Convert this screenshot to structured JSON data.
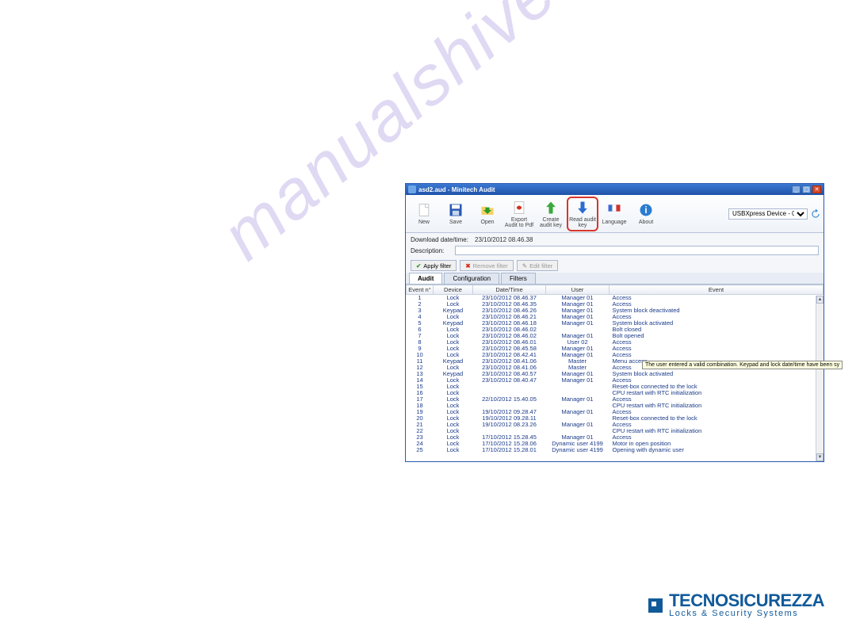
{
  "window": {
    "title": "asd2.aud - Minitech Audit"
  },
  "toolbar": {
    "new": "New",
    "save": "Save",
    "open": "Open",
    "export": "Export\nAudit to Pdf",
    "create": "Create\naudit key",
    "read": "Read audit\nkey",
    "lang": "Language",
    "about": "About"
  },
  "device": {
    "selected": "USBXpress Device - 0"
  },
  "info": {
    "dl_label": "Download date/time:",
    "dl_value": "23/10/2012 08.46.38",
    "desc_label": "Description:",
    "desc_value": ""
  },
  "filters": {
    "apply": "Apply filter",
    "remove": "Remove filter",
    "edit": "Edit filter"
  },
  "tabs": {
    "audit": "Audit",
    "config": "Configuration",
    "filters": "Filters"
  },
  "columns": {
    "n": "Event n°",
    "device": "Device",
    "dt": "Date/Time",
    "user": "User",
    "event": "Event"
  },
  "rows": [
    {
      "n": "1",
      "device": "Lock",
      "dt": "23/10/2012 08.46.37",
      "user": "Manager 01",
      "event": "Access"
    },
    {
      "n": "2",
      "device": "Lock",
      "dt": "23/10/2012 08.46.35",
      "user": "Manager 01",
      "event": "Access"
    },
    {
      "n": "3",
      "device": "Keypad",
      "dt": "23/10/2012 08.46.26",
      "user": "Manager 01",
      "event": "System block deactivated"
    },
    {
      "n": "4",
      "device": "Lock",
      "dt": "23/10/2012 08.46.21",
      "user": "Manager 01",
      "event": "Access"
    },
    {
      "n": "5",
      "device": "Keypad",
      "dt": "23/10/2012 08.46.18",
      "user": "Manager 01",
      "event": "System block activated"
    },
    {
      "n": "6",
      "device": "Lock",
      "dt": "23/10/2012 08.46.02",
      "user": "",
      "event": "Bolt closed"
    },
    {
      "n": "7",
      "device": "Lock",
      "dt": "23/10/2012 08.46.02",
      "user": "Manager 01",
      "event": "Bolt opened"
    },
    {
      "n": "8",
      "device": "Lock",
      "dt": "23/10/2012 08.46.01",
      "user": "User 02",
      "event": "Access"
    },
    {
      "n": "9",
      "device": "Lock",
      "dt": "23/10/2012 08.45.58",
      "user": "Manager 01",
      "event": "Access"
    },
    {
      "n": "10",
      "device": "Lock",
      "dt": "23/10/2012 08.42.41",
      "user": "Manager 01",
      "event": "Access"
    },
    {
      "n": "11",
      "device": "Keypad",
      "dt": "23/10/2012 08.41.06",
      "user": "Master",
      "event": "Menu access"
    },
    {
      "n": "12",
      "device": "Lock",
      "dt": "23/10/2012 08.41.06",
      "user": "Master",
      "event": "Access"
    },
    {
      "n": "13",
      "device": "Keypad",
      "dt": "23/10/2012 08.40.57",
      "user": "Manager 01",
      "event": "System block activated"
    },
    {
      "n": "14",
      "device": "Lock",
      "dt": "23/10/2012 08.40.47",
      "user": "Manager 01",
      "event": "Access"
    },
    {
      "n": "15",
      "device": "Lock",
      "dt": "",
      "user": "",
      "event": "Reset-box connected to the lock"
    },
    {
      "n": "16",
      "device": "Lock",
      "dt": "",
      "user": "",
      "event": "CPU restart with RTC initialization"
    },
    {
      "n": "17",
      "device": "Lock",
      "dt": "22/10/2012 15.40.05",
      "user": "Manager 01",
      "event": "Access"
    },
    {
      "n": "18",
      "device": "Lock",
      "dt": "",
      "user": "",
      "event": "CPU restart with RTC initialization"
    },
    {
      "n": "19",
      "device": "Lock",
      "dt": "19/10/2012 09.28.47",
      "user": "Manager 01",
      "event": "Access"
    },
    {
      "n": "20",
      "device": "Lock",
      "dt": "19/10/2012 09.28.11",
      "user": "",
      "event": "Reset-box connected to the lock"
    },
    {
      "n": "21",
      "device": "Lock",
      "dt": "19/10/2012 08.23.26",
      "user": "Manager 01",
      "event": "Access"
    },
    {
      "n": "22",
      "device": "Lock",
      "dt": "",
      "user": "",
      "event": "CPU restart with RTC initialization"
    },
    {
      "n": "23",
      "device": "Lock",
      "dt": "17/10/2012 15.28.45",
      "user": "Manager 01",
      "event": "Access"
    },
    {
      "n": "24",
      "device": "Lock",
      "dt": "17/10/2012 15.28.06",
      "user": "Dynamic user 4199",
      "event": "Motor in open position"
    },
    {
      "n": "25",
      "device": "Lock",
      "dt": "17/10/2012 15.28.01",
      "user": "Dynamic user 4199",
      "event": "Opening with dynamic user"
    }
  ],
  "tooltip": "The user entered a valid combination. Keypad and lock date/time have been sy",
  "watermark": "manualshiver.com",
  "footer": {
    "brand": "TECNOSICUREZZA",
    "sub": "Locks & Security Systems"
  }
}
